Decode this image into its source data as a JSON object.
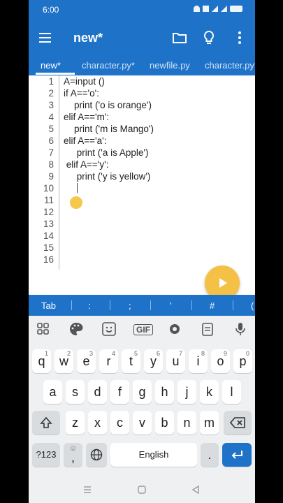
{
  "status": {
    "time": "6:00"
  },
  "toolbar": {
    "title": "new*"
  },
  "tabs": [
    "new*",
    "character.py*",
    "newfile.py",
    "character.py*"
  ],
  "editor": {
    "line_numbers": [
      "1",
      "2",
      "3",
      "4",
      "5",
      "6",
      "7",
      "8",
      "9",
      "10",
      "11",
      "12",
      "13",
      "14",
      "15",
      "16"
    ],
    "lines": [
      "A=input ()",
      "if A=='o':",
      "    print ('o is orange')",
      "elif A=='m':",
      "    print ('m is Mango')",
      "elif A=='a':",
      "     print ('a is Apple')",
      " elif A=='y':",
      "     print ('y is yellow')"
    ]
  },
  "symbols": [
    "Tab",
    ":",
    ";",
    "'",
    "#",
    "("
  ],
  "keyboard": {
    "row1": [
      {
        "k": "q",
        "s": "1"
      },
      {
        "k": "w",
        "s": "2"
      },
      {
        "k": "e",
        "s": "3"
      },
      {
        "k": "r",
        "s": "4"
      },
      {
        "k": "t",
        "s": "5"
      },
      {
        "k": "y",
        "s": "6"
      },
      {
        "k": "u",
        "s": "7"
      },
      {
        "k": "i",
        "s": "8"
      },
      {
        "k": "o",
        "s": "9"
      },
      {
        "k": "p",
        "s": "0"
      }
    ],
    "row2": [
      "a",
      "s",
      "d",
      "f",
      "g",
      "h",
      "j",
      "k",
      "l"
    ],
    "row3": [
      "z",
      "x",
      "c",
      "v",
      "b",
      "n",
      "m"
    ],
    "sym_key": "?123",
    "comma": ",",
    "space": "English",
    "period": "."
  },
  "colors": {
    "accent": "#1e73c8",
    "fab": "#f5c046",
    "handle": "#f4c84a"
  }
}
